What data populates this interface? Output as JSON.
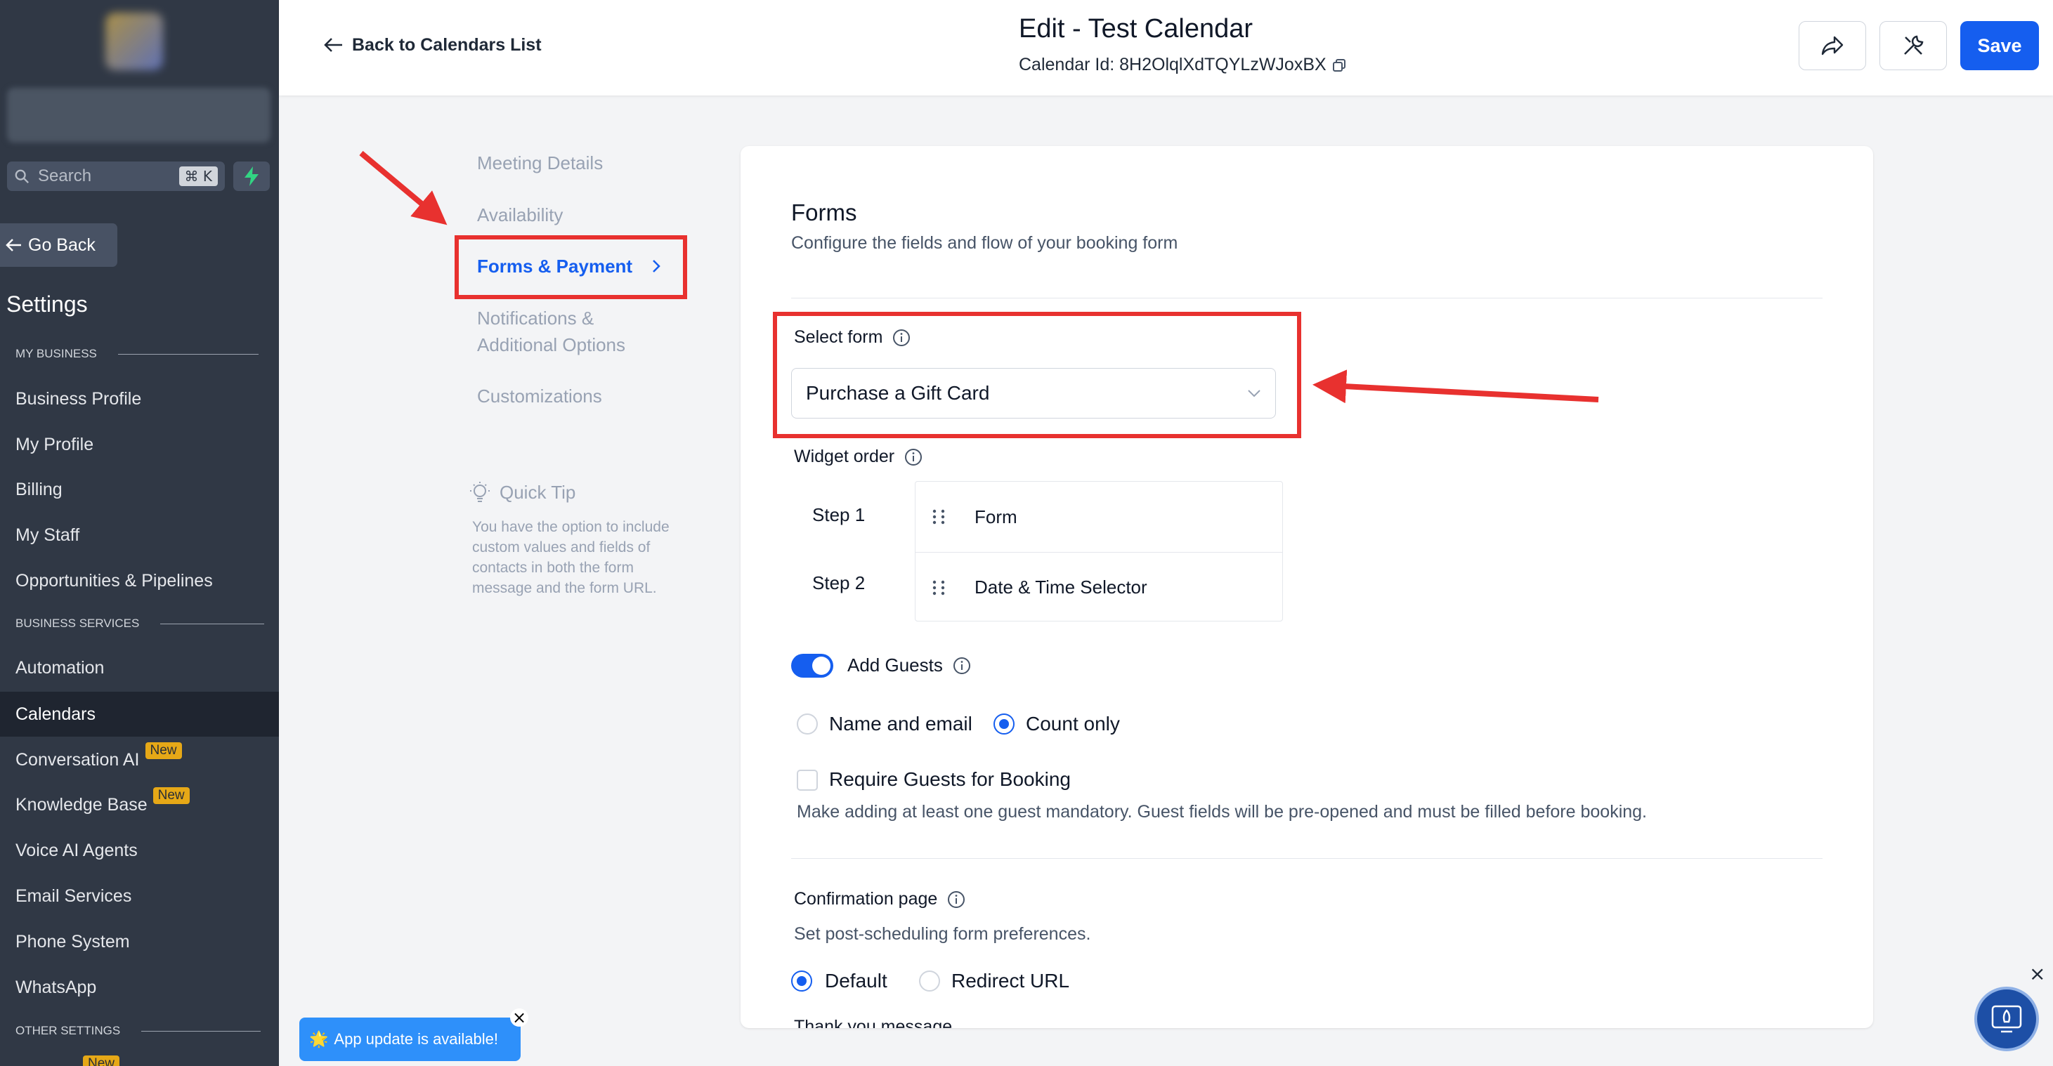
{
  "sidebar": {
    "search_placeholder": "Search",
    "search_shortcut": "⌘ K",
    "go_back": "Go Back",
    "title": "Settings",
    "section_my_business": "MY BUSINESS",
    "section_business_services": "BUSINESS SERVICES",
    "section_other_settings": "OTHER SETTINGS",
    "items": [
      {
        "label": "Business Profile"
      },
      {
        "label": "My Profile"
      },
      {
        "label": "Billing"
      },
      {
        "label": "My Staff"
      },
      {
        "label": "Opportunities & Pipelines"
      },
      {
        "label": "Automation"
      },
      {
        "label": "Calendars"
      },
      {
        "label": "Conversation AI",
        "badge": "New"
      },
      {
        "label": "Knowledge Base",
        "badge": "New"
      },
      {
        "label": "Voice AI Agents"
      },
      {
        "label": "Email Services"
      },
      {
        "label": "Phone System"
      },
      {
        "label": "WhatsApp"
      }
    ],
    "bottom_badge": "New"
  },
  "header": {
    "back_label": "Back to Calendars List",
    "title": "Edit - Test Calendar",
    "calendar_id": "Calendar Id: 8H2OlqlXdTQYLzWJoxBX",
    "save_label": "Save"
  },
  "subnav": {
    "items": [
      "Meeting Details",
      "Availability",
      "Forms & Payment",
      "Notifications & Additional Options",
      "Customizations"
    ],
    "active": "Forms & Payment",
    "tip_title": "Quick Tip",
    "tip_text": "You have the option to include custom values and fields of contacts in both the form message and the form URL."
  },
  "forms": {
    "title": "Forms",
    "subtitle": "Configure the fields and flow of your booking form",
    "select_form_label": "Select form",
    "select_form_value": "Purchase a Gift Card",
    "widget_order_label": "Widget order",
    "steps": [
      {
        "step": "Step 1",
        "widget": "Form"
      },
      {
        "step": "Step 2",
        "widget": "Date & Time Selector"
      }
    ],
    "add_guests_label": "Add Guests",
    "add_guests_enabled": true,
    "guest_options": [
      "Name and email",
      "Count only"
    ],
    "guest_option_selected": "Count only",
    "require_guests_label": "Require Guests for Booking",
    "require_guests_checked": false,
    "require_guests_help": "Make adding at least one guest mandatory. Guest fields will be pre-opened and must be filled before booking.",
    "confirmation_label": "Confirmation page",
    "confirmation_help": "Set post-scheduling form preferences.",
    "confirmation_options": [
      "Default",
      "Redirect URL"
    ],
    "confirmation_selected": "Default",
    "cut_off_label": "Thank you message"
  },
  "toast": {
    "text": "App update is available!",
    "emoji": "🌟"
  },
  "colors": {
    "sidebar_bg": "#303845",
    "primary": "#155eef",
    "annotation_red": "#e8312f",
    "badge": "#e6a817"
  }
}
